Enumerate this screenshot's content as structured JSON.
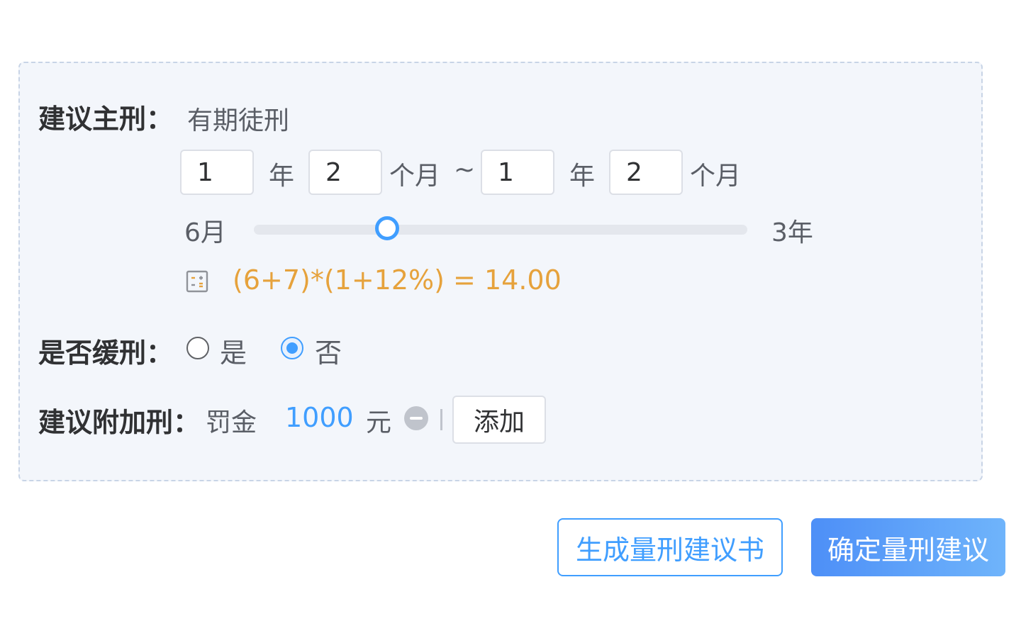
{
  "main_penalty": {
    "label": "建议主刑：",
    "type": "有期徒刑",
    "min_years": "1",
    "min_months": "2",
    "max_years": "1",
    "max_months": "2",
    "unit_year": "年",
    "unit_month": "个月",
    "range_sep": "~",
    "slider": {
      "min_label": "6月",
      "max_label": "3年",
      "value_fraction": 0.27
    },
    "calc_icon": "calculator-icon",
    "formula": "(6+7)*(1+12%) = 14.00"
  },
  "probation": {
    "label": "是否缓刑：",
    "options": [
      {
        "label": "是",
        "checked": false
      },
      {
        "label": "否",
        "checked": true
      }
    ]
  },
  "additional_penalty": {
    "label": "建议附加刑：",
    "type": "罚金",
    "amount": "1000",
    "unit": "元",
    "remove_icon": "minus-circle-icon",
    "separator": "|",
    "add_label": "添加"
  },
  "actions": {
    "generate_label": "生成量刑建议书",
    "confirm_label": "确定量刑建议"
  },
  "colors": {
    "accent": "#409eff",
    "formula": "#e6a23c",
    "panel_bg": "#f3f6fb",
    "panel_border": "#c8d4e6"
  }
}
